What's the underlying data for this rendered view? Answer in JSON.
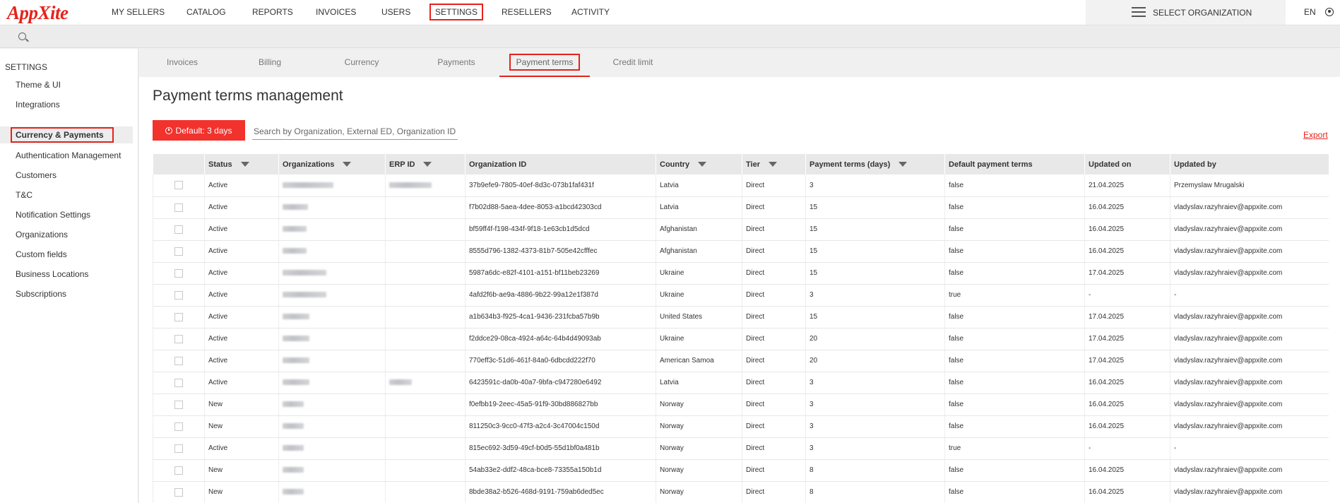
{
  "brand": {
    "logo_text": "AppXite",
    "accent": "#e5231b"
  },
  "topnav": {
    "items": [
      "MY SELLERS",
      "CATALOG",
      "REPORTS",
      "INVOICES",
      "USERS",
      "SETTINGS",
      "RESELLERS",
      "ACTIVITY"
    ],
    "active": "SETTINGS",
    "org_select_label": "SELECT ORGANIZATION",
    "language": "EN"
  },
  "sidebar": {
    "title": "SETTINGS",
    "items": [
      "Theme & UI",
      "Integrations",
      "Currency & Payments",
      "Authentication Management",
      "Customers",
      "T&C",
      "Notification Settings",
      "Organizations",
      "Custom fields",
      "Business Locations",
      "Subscriptions"
    ],
    "active": "Currency & Payments"
  },
  "tabs": {
    "items": [
      "Invoices",
      "Billing",
      "Currency",
      "Payments",
      "Payment terms",
      "Credit limit"
    ],
    "active": "Payment terms"
  },
  "main": {
    "title": "Payment terms management",
    "default_button": "Default: 3 days",
    "search_placeholder": "Search by Organization, External ED, Organization ID",
    "export_label": "Export"
  },
  "table": {
    "columns": [
      "",
      "Status",
      "Organizations",
      "ERP ID",
      "Organization ID",
      "Country",
      "Tier",
      "Payment terms (days)",
      "Default payment terms",
      "Updated on",
      "Updated by"
    ],
    "filterable": [
      false,
      true,
      true,
      true,
      false,
      true,
      true,
      true,
      false,
      false,
      false
    ],
    "rows": [
      [
        "Active",
        "37b9efe9-7805-40ef-8d3c-073b1faf431f",
        "Latvia",
        "Direct",
        "3",
        "false",
        "21.04.2025",
        "Przemyslaw Mrugalski"
      ],
      [
        "Active",
        "f7b02d88-5aea-4dee-8053-a1bcd42303cd",
        "Latvia",
        "Direct",
        "15",
        "false",
        "16.04.2025",
        "vladyslav.razyhraiev@appxite.com"
      ],
      [
        "Active",
        "bf59ff4f-f198-434f-9f18-1e63cb1d5dcd",
        "Afghanistan",
        "Direct",
        "15",
        "false",
        "16.04.2025",
        "vladyslav.razyhraiev@appxite.com"
      ],
      [
        "Active",
        "8555d796-1382-4373-81b7-505e42cfffec",
        "Afghanistan",
        "Direct",
        "15",
        "false",
        "16.04.2025",
        "vladyslav.razyhraiev@appxite.com"
      ],
      [
        "Active",
        "5987a6dc-e82f-4101-a151-bf11beb23269",
        "Ukraine",
        "Direct",
        "15",
        "false",
        "17.04.2025",
        "vladyslav.razyhraiev@appxite.com"
      ],
      [
        "Active",
        "4afd2f6b-ae9a-4886-9b22-99a12e1f387d",
        "Ukraine",
        "Direct",
        "3",
        "true",
        "-",
        "-"
      ],
      [
        "Active",
        "a1b634b3-f925-4ca1-9436-231fcba57b9b",
        "United States",
        "Direct",
        "15",
        "false",
        "17.04.2025",
        "vladyslav.razyhraiev@appxite.com"
      ],
      [
        "Active",
        "f2ddce29-08ca-4924-a64c-64b4d49093ab",
        "Ukraine",
        "Direct",
        "20",
        "false",
        "17.04.2025",
        "vladyslav.razyhraiev@appxite.com"
      ],
      [
        "Active",
        "770eff3c-51d6-461f-84a0-6dbcdd222f70",
        "American Samoa",
        "Direct",
        "20",
        "false",
        "17.04.2025",
        "vladyslav.razyhraiev@appxite.com"
      ],
      [
        "Active",
        "6423591c-da0b-40a7-9bfa-c947280e6492",
        "Latvia",
        "Direct",
        "3",
        "false",
        "16.04.2025",
        "vladyslav.razyhraiev@appxite.com"
      ],
      [
        "New",
        "f0efbb19-2eec-45a5-91f9-30bd886827bb",
        "Norway",
        "Direct",
        "3",
        "false",
        "16.04.2025",
        "vladyslav.razyhraiev@appxite.com"
      ],
      [
        "New",
        "811250c3-9cc0-47f3-a2c4-3c47004c150d",
        "Norway",
        "Direct",
        "3",
        "false",
        "16.04.2025",
        "vladyslav.razyhraiev@appxite.com"
      ],
      [
        "Active",
        "815ec692-3d59-49cf-b0d5-55d1bf0a481b",
        "Norway",
        "Direct",
        "3",
        "true",
        "-",
        "-"
      ],
      [
        "New",
        "54ab33e2-ddf2-48ca-bce8-73355a150b1d",
        "Norway",
        "Direct",
        "8",
        "false",
        "16.04.2025",
        "vladyslav.razyhraiev@appxite.com"
      ],
      [
        "New",
        "8bde38a2-b526-468d-9191-759ab6ded5ec",
        "Norway",
        "Direct",
        "8",
        "false",
        "16.04.2025",
        "vladyslav.razyhraiev@appxite.com"
      ]
    ]
  }
}
